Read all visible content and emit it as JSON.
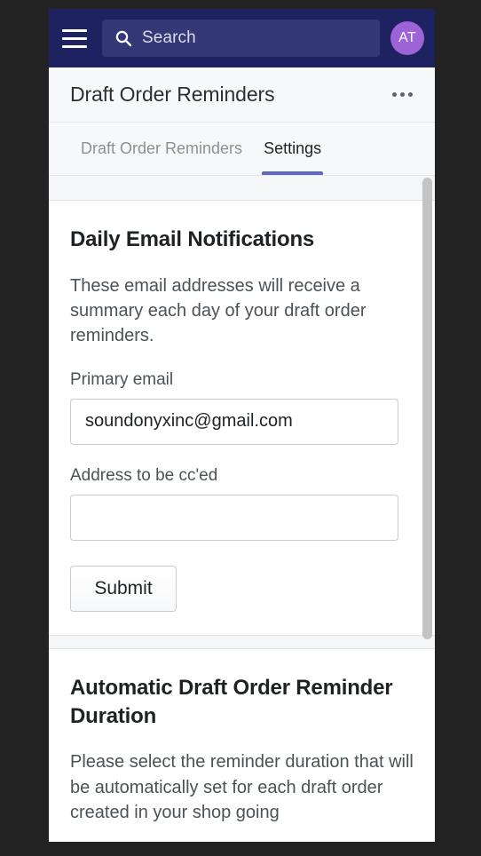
{
  "topbar": {
    "menu_icon": "hamburger-icon",
    "search": {
      "icon": "search-icon",
      "placeholder": "Search",
      "value": ""
    },
    "avatar": {
      "initials": "AT",
      "color": "#9e63d6"
    },
    "background_color": "#1f2260"
  },
  "header": {
    "title": "Draft Order Reminders",
    "overflow_icon": "ellipsis-horizontal-icon"
  },
  "tabs": [
    {
      "label": "Draft Order Reminders",
      "active": false
    },
    {
      "label": "Settings",
      "active": true
    }
  ],
  "tab_accent_color": "#5c6ac4",
  "cards": [
    {
      "title": "Daily Email Notifications",
      "description": "These email addresses will receive a summary each day of your draft order reminders.",
      "fields": [
        {
          "label": "Primary email",
          "value": "soundonyxinc@gmail.com",
          "placeholder": ""
        },
        {
          "label": "Address to be cc'ed",
          "value": "",
          "placeholder": ""
        }
      ],
      "submit_label": "Submit"
    },
    {
      "title": "Automatic Draft Order Reminder Duration",
      "description": "Please select the reminder duration that will be automatically set for each draft order created in your shop going"
    }
  ],
  "scrollbar": {
    "orientation": "vertical",
    "visible": true
  }
}
